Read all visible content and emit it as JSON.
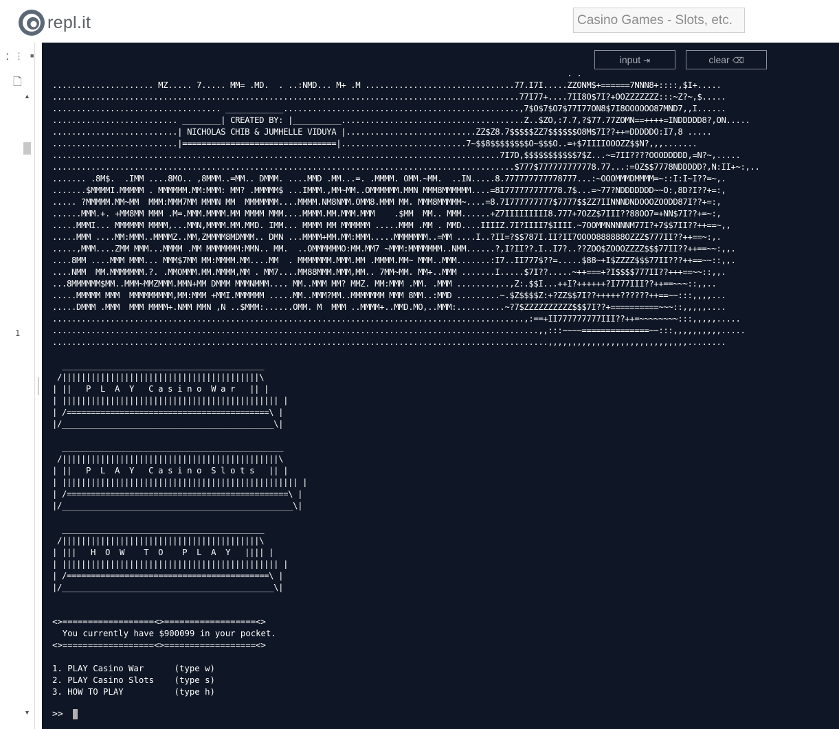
{
  "app": {
    "logo_text": "repl.it",
    "project_title": "Casino Games - Slots, etc."
  },
  "editor": {
    "line_number": "1"
  },
  "console": {
    "input_label": "input",
    "clear_label": "clear",
    "art": [
      "                                                                                                           . .  ",
      "..................... MZ..... 7..... MM= .MD.  . ..:NMD... M+ .M ...............................77.I7I.....ZZONM$+======7NNN8+::::,$I+.....",
      ".................................................................................................77I77+....7II8O$7I?+OOZZZZZZZ:::~Z?~,$.....",
      "................................... ____________.................................................,7$O$7$O7$77I77ON8$7I8OOOOOO87MND7,,I......",
      ".......................... ________| CREATED BY: |__________......................................Z..$ZO,:7.7,?$77.77ZOMN==++++=INDDDDD8?,ON.....",
      "..........................| NICHOLAS CHIB & JUMHELLE VIDUYA |...........................ZZ$Z8.7$$$$$ZZ7$$$$$$O8M$7I??++=DDDDDO:I7,8 .....",
      "..........................|================================|..........................7~$$8$$$$$$$$O~$$$O..=+$7IIIIOOOZZ$$N?,,,.......",
      ".............................................................................................7I7D,$$$$$$$$$$$7$Z...~=7II????OOODDDDD,=N?~,.....",
      "................................................................................................$777$777777777778.77...:=OZ$$7778NDDDDD?,N:II+~:,..",
      "....... .8M$.  .IMM ....8MO.. ,8MMM..=MM.. DMMM. ....MMD .MM...=. .MMMM. OMM.~MM.  ..IN.....8.777777777778777...:~OOOMMMDMMMM=~::I:I~I??=~,.",
      ".......$MMMMI.MMMMM . MMMMMM.MM:MMM: MM? .MMMMM$ ...IMMM.,MM~MM..OMMMMMM.MMN MMM8MMMMMM....=8I777777777778.7$...=~77?NDDDDDDD~~O:,8D?I??+=:,",
      "..... ?MMMMM.MM~MM  MMM:MMM7MM MMMN MM  MMMMMMM....MMMM.NM8NMM.OMM8.MMM MM. MMM8MMMMM~....=8.7I777777777$7777$$ZZ7IINNNDNDOOOZOODD87I??+=:,",
      "......MMM.+. +MM8MM MMM .M=.MMM.MMMM.MM MMMM MMM....MMMM.MM.MMM.MMM    .$MM  MM.. MMM......+Z7IIIIIIIII8.777+7OZZ$7III??88OO7=+NN$7I??+=~:,",
      ".....MMMI... MMMMMM MMMM,...MMN,MMMM.MM.MMD. IMM... MMMM MM MMMMMM .....MMM .MM . MMD....IIIIZ.7I?IIII7$IIII.~7OOMMNNNNNM77I?+7$$7II??++==~,,",
      ".....MMM ....MM:MMM..MMMMZ..MM,ZMMMM8MDMMM.. DMN ...MMMM+MM.MM:MMM.....MMMMMMM..=MM ....I..?II=?$$787I.II?II7OOOO888888OZZZ$777II??++==~:,.",
      ".....,MMM....ZMM MMM...MMMM .MM MMMMMMM:MMN.. MM.  ..OMMMMMMO:MM.MM7 ~MMM:MMMMMMM..NMM......?,I?II??.I..I7?..??ZOO$ZOOOZZZZ$$$77II??++==~~:,,.",
      "....8MM ....MMM MMM... MMM$7MM MM:MMMM.MM....MM  . MMMMMMM.MMM.MM .MMMM.MM~ MMM..MMM.......:I7..II777$??=.....$88~+I$ZZZZ$$$77II???++==~~::,,.",
      "....NMM  MM.MMMMMMM.?. .MMOMMM.MM.MMMM,MM . MM7....MM88MMM.MMM,MM.. 7MM~MM. MM+..MMM .......I.....$7I??.....~++===+?I$$$$777II??+++==~~::,,.",
      "...8MMMMMM$MM..MMM~MMZMMM.MMN+MM DMMM MMMNMMM.... MM..MMM MM? MMZ. MM:MMM .MM. .MMM ........,..,Z:.$$I...++I?++++++?I777III??++==~~~::,,..",
      ".....MMMMM MMM  MMMMMMMMM,MM:MMM +MMI.MMMMMM .....MM..MMM?MM..MMMMMMM MMM 8MM..:MMD .........~.$Z$$$$Z:+?ZZ$$7I??+++++??????++==~~:::,,,,...",
      ".....DMMM .MMM  MMM MMMM+.NMM MMN ,N ..$MMM:......OMM. M  MMM ..MMMM+..MMD.MO,..MMM:..........~?7$ZZZZZZZZZZ$$$7I??+==========~~~::,,,,,....",
      "..................................................................................................,:==+II777777777III??++=~~~~~~~~:::,,,,,.....",
      ".....................................................................................................,,:::~~~~==============~~:::,,,,,,,,,,.....",
      ".......................................................................................................,,,,,,,,,,,,,,,,,,,,,,,,,,,,,........"
    ],
    "banner_war": [
      "  __________________________________________",
      " /|||||||||||||||||||||||||||||||||||||||||\\",
      "| ||   P  L  A  Y   C a s i n o  W a r   || |",
      "| ||||||||||||||||||||||||||||||||||||||||||||| |",
      "| /==========================================\\ |",
      "|/____________________________________________\\|"
    ],
    "banner_slots": [
      "  ______________________________________________",
      " /|||||||||||||||||||||||||||||||||||||||||||||\\",
      "| ||   P  L  A  Y   C a s i n o  S l o t s   || |",
      "| ||||||||||||||||||||||||||||||||||||||||||||||||| |",
      "| /==============================================\\ |",
      "|/________________________________________________\\|"
    ],
    "banner_howto": [
      "  __________________________________________",
      " /|||||||||||||||||||||||||||||||||||||||||\\",
      "| |||   H  O  W    T  O    P  L  A  Y   |||| |",
      "| ||||||||||||||||||||||||||||||||||||||||||||| |",
      "| /==========================================\\ |",
      "|/____________________________________________\\|"
    ],
    "pocket_border_top": "<>==================<>==================<>",
    "pocket_text": "  You currently have $900099 in your pocket.",
    "pocket_border_bottom": "<>==================<>==================<>",
    "menu": [
      "1. PLAY Casino War      (type w)",
      "2. PLAY Casino Slots    (type s)",
      "3. HOW TO PLAY          (type h)"
    ],
    "prompt": ">>"
  }
}
